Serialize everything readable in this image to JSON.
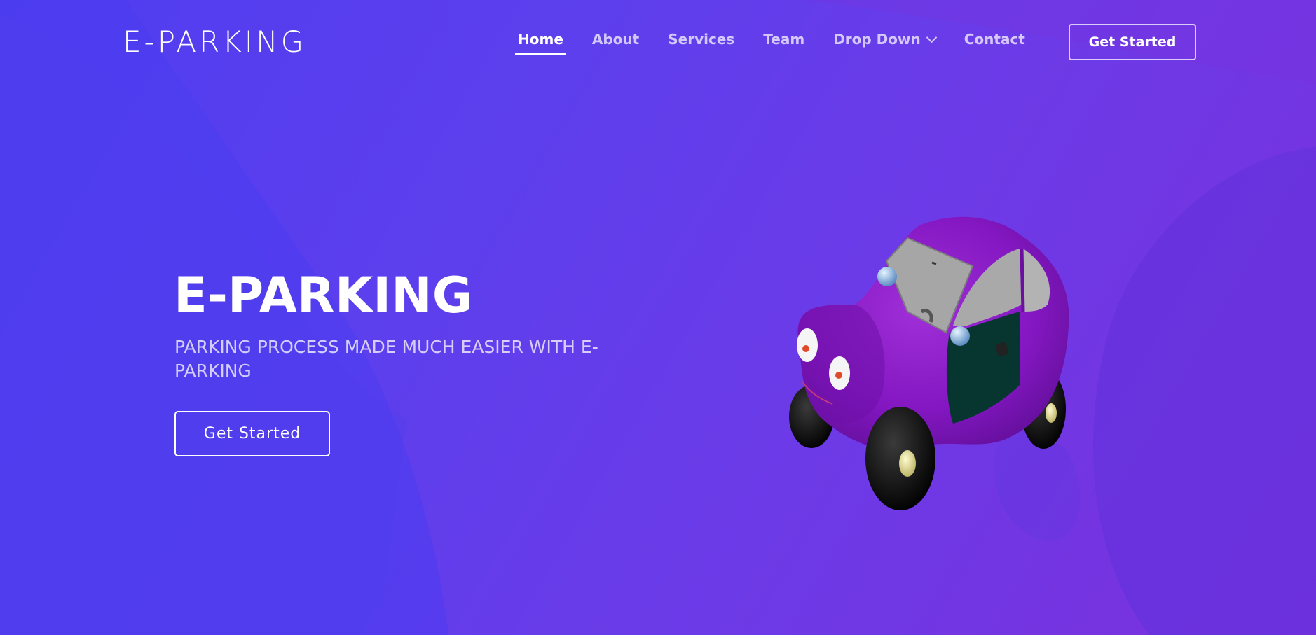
{
  "brand": {
    "logo_text": "E-PARKING"
  },
  "nav": {
    "items": [
      {
        "label": "Home",
        "active": true
      },
      {
        "label": "About"
      },
      {
        "label": "Services"
      },
      {
        "label": "Team"
      },
      {
        "label": "Drop Down",
        "has_dropdown": true
      },
      {
        "label": "Contact"
      }
    ],
    "cta_label": "Get Started"
  },
  "hero": {
    "title": "E-PARKING",
    "subtitle": "PARKING PROCESS MADE MUCH EASIER WITH E-PARKING",
    "cta_label": "Get Started"
  },
  "illustration": {
    "icon": "purple-car-icon"
  },
  "colors": {
    "background_start": "#4f3df0",
    "background_end": "#7a30dc",
    "text": "#ffffff",
    "car_body": "#8a1fc7"
  }
}
